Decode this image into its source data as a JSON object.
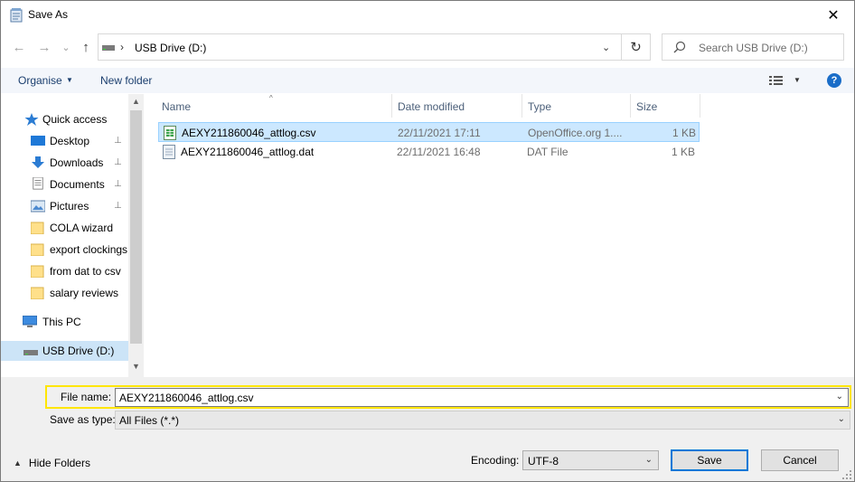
{
  "window": {
    "title": "Save As",
    "close_label": "✕"
  },
  "address_bar": {
    "path_segments": [
      "USB Drive (D:)"
    ],
    "separator": "›",
    "dropdown_label": "⌄",
    "refresh_label": "↻"
  },
  "search": {
    "placeholder": "Search USB Drive (D:)"
  },
  "nav_buttons": {
    "back": "←",
    "forward": "→",
    "recent": "⌄",
    "up": "↑"
  },
  "toolbar": {
    "organise_label": "Organise",
    "organise_dd": "▼",
    "new_folder_label": "New folder",
    "view_dd": "▼",
    "help_label": "?"
  },
  "sidebar": {
    "items": [
      {
        "label": "Quick access",
        "icon": "star-icon",
        "pinned": false
      },
      {
        "label": "Desktop",
        "icon": "desktop-icon",
        "pinned": true
      },
      {
        "label": "Downloads",
        "icon": "download-icon",
        "pinned": true
      },
      {
        "label": "Documents",
        "icon": "documents-icon",
        "pinned": true
      },
      {
        "label": "Pictures",
        "icon": "pictures-icon",
        "pinned": true
      },
      {
        "label": "COLA wizard",
        "icon": "folder-icon",
        "pinned": false
      },
      {
        "label": "export clockings",
        "icon": "folder-icon",
        "pinned": false
      },
      {
        "label": "from dat to csv",
        "icon": "folder-icon",
        "pinned": false
      },
      {
        "label": "salary reviews",
        "icon": "folder-icon",
        "pinned": false
      },
      {
        "label": "This PC",
        "icon": "computer-icon",
        "pinned": false
      },
      {
        "label": "USB Drive (D:)",
        "icon": "usb-drive-icon",
        "pinned": false,
        "selected": true
      }
    ],
    "pin_glyph": "📌",
    "scroll_up": "▲",
    "scroll_down": "▼"
  },
  "file_list": {
    "columns": [
      "Name",
      "Date modified",
      "Type",
      "Size"
    ],
    "sort_glyph": "^",
    "rows": [
      {
        "name": "AEXY211860046_attlog.csv",
        "date": "22/11/2021 17:11",
        "type": "OpenOffice.org 1....",
        "size": "1 KB",
        "icon": "spreadsheet-file-icon",
        "selected": true
      },
      {
        "name": "AEXY211860046_attlog.dat",
        "date": "22/11/2021 16:48",
        "type": "DAT File",
        "size": "1 KB",
        "icon": "generic-file-icon",
        "selected": false
      }
    ]
  },
  "form": {
    "file_name_label": "File name:",
    "file_name_value": "AEXY211860046_attlog.csv",
    "save_as_type_label": "Save as type:",
    "save_as_type_value": "All Files  (*.*)",
    "dropdown_glyph": "⌄",
    "hide_folders_label": "Hide Folders",
    "hide_folders_glyph": "▲",
    "encoding_label": "Encoding:",
    "encoding_value": "UTF-8",
    "save_label": "Save",
    "cancel_label": "Cancel"
  },
  "colors": {
    "accent": "#0078d7",
    "selection_bg": "#cce8ff",
    "highlight_border": "#ffe600"
  }
}
